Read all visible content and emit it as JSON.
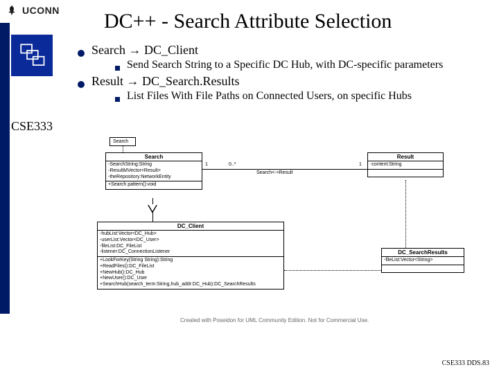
{
  "header": {
    "org": "UCONN"
  },
  "title": "DC++ - Search Attribute Selection",
  "course": "CSE333",
  "bullets": {
    "b1a": "Search",
    "b1a_arrow": "→",
    "b1a_rhs": "DC_Client",
    "b2a": "Send Search String to a Specific DC Hub, with DC-specific parameters",
    "b1b": "Result",
    "b1b_arrow": "→",
    "b1b_rhs": "DC_Search.Results",
    "b2b": "List Files With File Paths on Connected Users, on specific Hubs"
  },
  "uml": {
    "note": "Search",
    "search_title": "Search",
    "search_attrs": "-SearchString:String\n-ResultMVector<Result>\n-theRepository:NetworkEntity",
    "search_ops": "+Search pattern():void",
    "result_title": "Result",
    "result_attrs": "-content:String",
    "assoc_left": "1",
    "assoc_mid": "0..*",
    "assoc_label": "Search<->Result",
    "assoc_right": "1",
    "client_title": "DC_Client",
    "client_attrs": "-hubList:Vector<DC_Hub>\n-userList:Vector<DC_User>\n-fileList:DC_FileList\n-listener:DC_ConnectionListener",
    "client_ops": "+LookForKey(String String):String\n+ReadFiles():DC_FileList\n+NewHub():DC_Hub\n+NewUser():DC_User\n+SearchHub(search_term:String,hub_addr:DC_Hub):DC_SearchResults",
    "sresults_title": "DC_SearchResults",
    "sresults_attrs": "-fileList:Vector<String>",
    "watermark": "Created with Poseidon for UML Community Edition. Not for Commercial Use."
  },
  "footer": "CSE333 DDS.83"
}
